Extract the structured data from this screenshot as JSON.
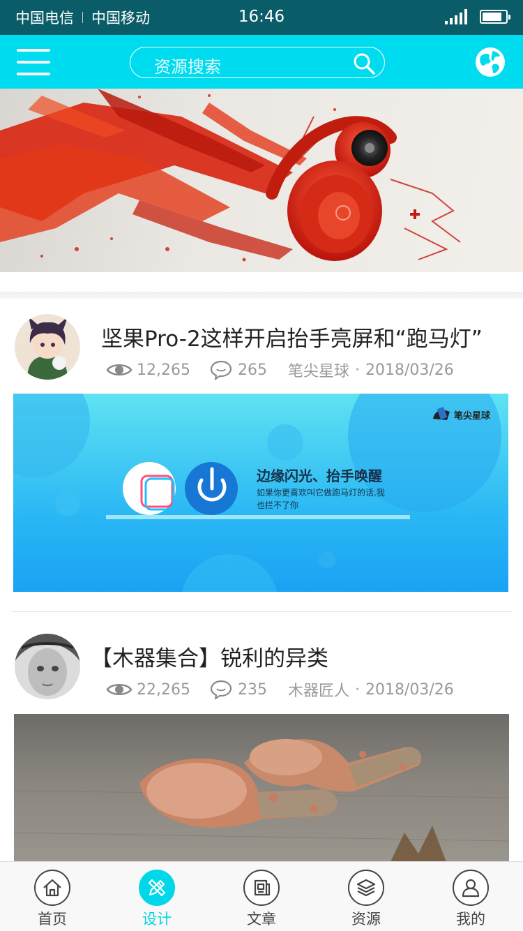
{
  "status_bar": {
    "carrier_1": "中国电信",
    "carrier_2": "中国移动",
    "time": "16:46",
    "battery_level": 0.85
  },
  "header": {
    "menu_icon": "hamburger-icon",
    "search_placeholder": "资源搜索",
    "search_icon": "search-icon",
    "globe_icon": "globe-icon"
  },
  "colors": {
    "accent": "#00dcef",
    "status_bar_bg": "#0a5d68",
    "tab_active": "#00d4e6"
  },
  "articles": [
    {
      "title": "坚果Pro-2这样开启抬手亮屏和“跑马灯”",
      "views": "12,265",
      "comments": "265",
      "author": "笔尖星球",
      "separator": "·",
      "date": "2018/03/26",
      "image": {
        "brand": "笔尖星球",
        "headline": "边缘闪光、抬手唤醒",
        "body_line_1": "如果你更喜欢叫它做跑马灯的话,我",
        "body_line_2": "也拦不了你"
      }
    },
    {
      "title": "【木器集合】锐利的异类",
      "views": "22,265",
      "comments": "235",
      "author": "木器匠人",
      "separator": "·",
      "date": "2018/03/26"
    }
  ],
  "bottom_nav": [
    {
      "label": "首页",
      "icon": "home-icon",
      "active": false
    },
    {
      "label": "设计",
      "icon": "design-pencil-icon",
      "active": true
    },
    {
      "label": "文章",
      "icon": "article-icon",
      "active": false
    },
    {
      "label": "资源",
      "icon": "layers-icon",
      "active": false
    },
    {
      "label": "我的",
      "icon": "user-icon",
      "active": false
    }
  ]
}
